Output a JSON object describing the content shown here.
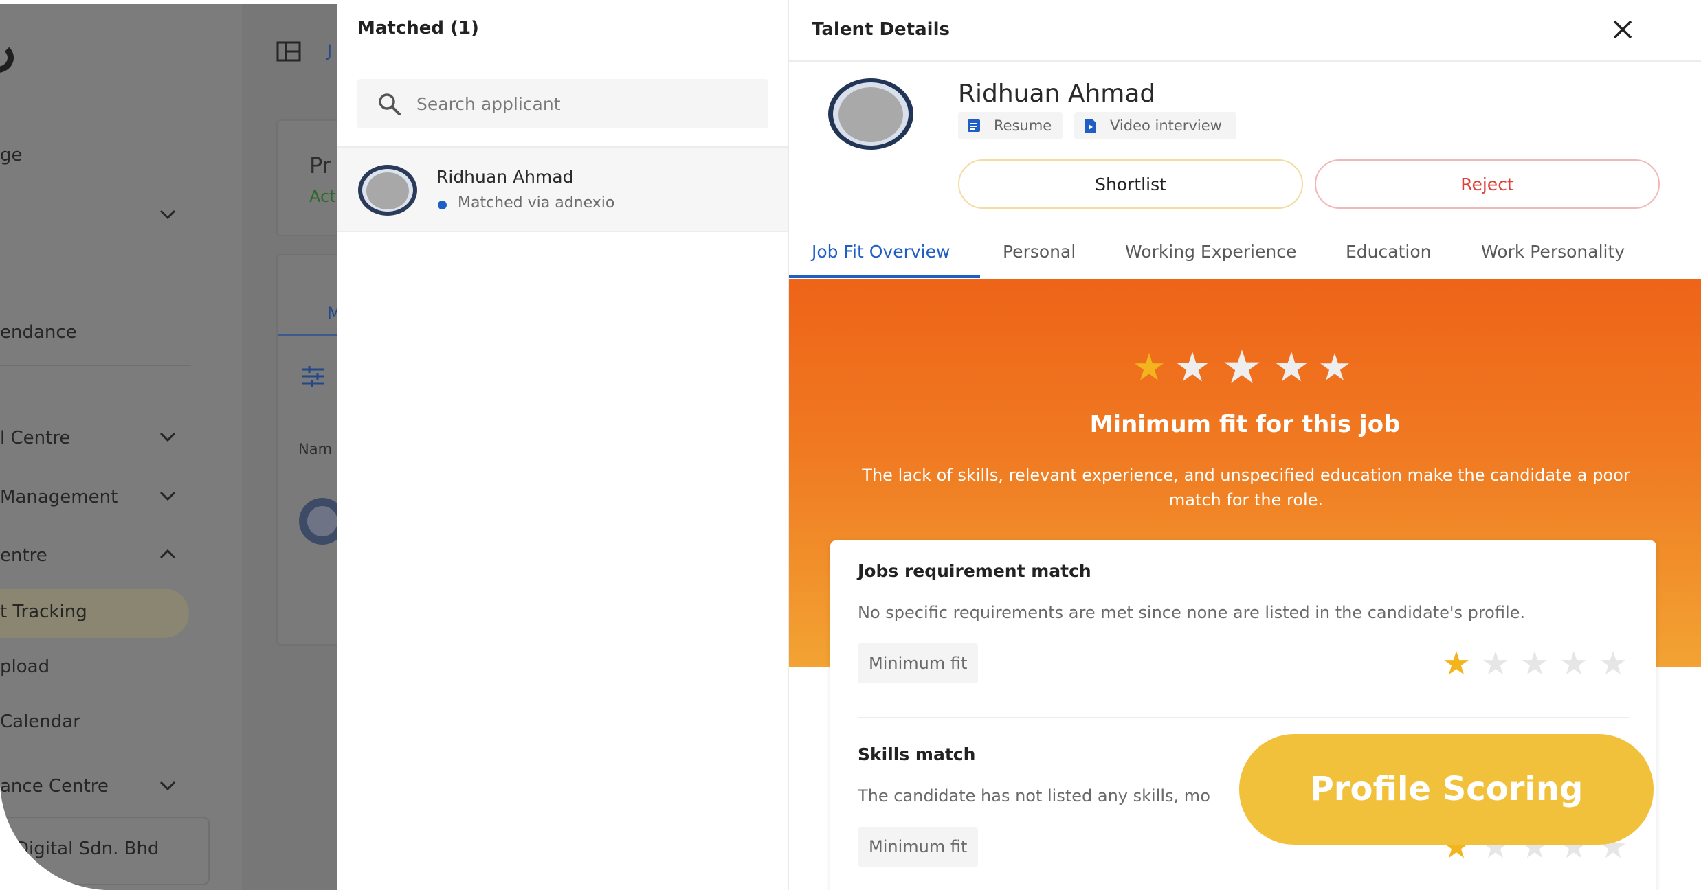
{
  "background_app": {
    "sidebar_items": [
      "ge",
      "endance",
      "l Centre",
      "Management",
      "entre",
      "t Tracking",
      "pload",
      " Calendar",
      "ance Centre"
    ],
    "company": "Digital Sdn. Bhd",
    "card_title_fragment": "Pr",
    "card_status_fragment": "Act",
    "tab_fragment": "M",
    "column_fragment": "Nam",
    "header_fragment": "J"
  },
  "matched": {
    "title": "Matched (1)",
    "search_placeholder": "Search applicant",
    "applicant": {
      "name": "Ridhuan Ahmad",
      "source": "Matched via adnexio"
    }
  },
  "talent": {
    "title": "Talent Details",
    "name": "Ridhuan Ahmad",
    "chips": {
      "resume": "Resume",
      "video": "Video interview"
    },
    "buttons": {
      "shortlist": "Shortlist",
      "reject": "Reject"
    },
    "tabs": [
      "Job Fit Overview",
      "Personal",
      "Working Experience",
      "Education",
      "Work Personality"
    ],
    "active_tab": "Job Fit Overview",
    "overview": {
      "rating": 1,
      "rating_max": 5,
      "title": "Minimum fit for this job",
      "description": "The lack of skills, relevant experience, and unspecified education make the candidate a poor match for the role."
    },
    "sections": [
      {
        "title": "Jobs requirement match",
        "description": "No specific requirements are met since none are listed in the candidate's profile.",
        "tag": "Minimum fit",
        "rating": 1
      },
      {
        "title": "Skills match",
        "description": "The candidate has not listed any skills, mo",
        "tag": "Minimum fit",
        "rating": 1
      }
    ]
  },
  "callout": "Profile Scoring",
  "colors": {
    "accent_blue": "#1f5fc5",
    "reject_red": "#e0403a",
    "star_gold": "#f2b51e",
    "callout": "#f2c13c",
    "hero_orange": "#ee6418"
  }
}
